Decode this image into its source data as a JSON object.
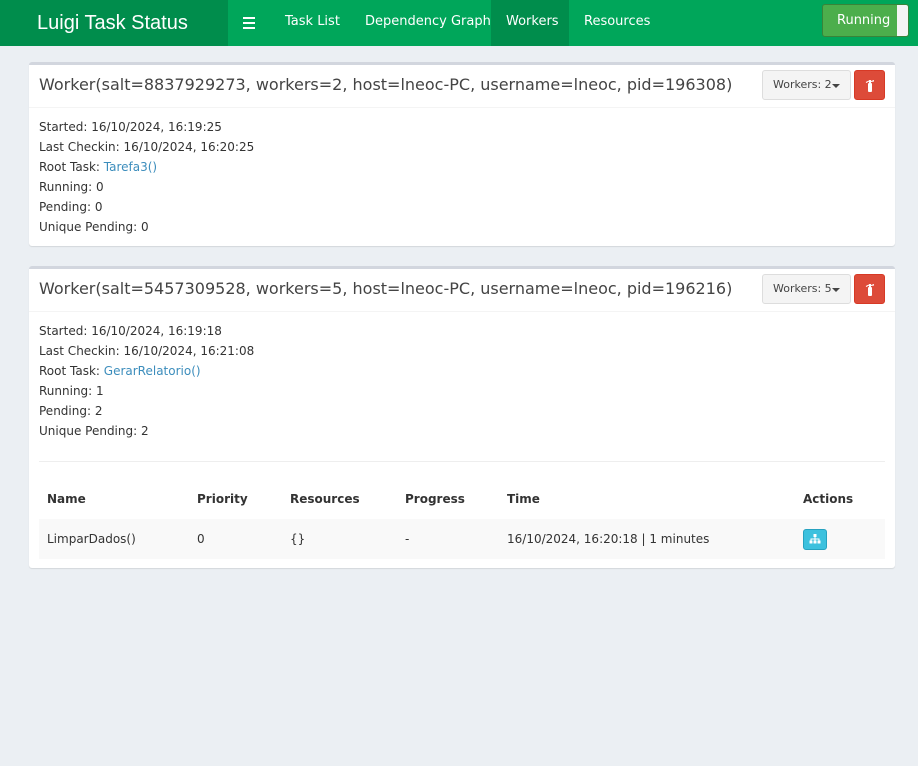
{
  "app": {
    "title": "Luigi Task Status",
    "status_label": "Running"
  },
  "nav": {
    "items": [
      "Task List",
      "Dependency Graph",
      "Workers",
      "Resources"
    ],
    "active": "Workers"
  },
  "colors": {
    "nav_bg": "#00a65a",
    "brand_bg": "#008d4c",
    "danger": "#dd4b39",
    "link": "#3c8dbc",
    "info": "#3cc1de"
  },
  "workers": [
    {
      "title": "Worker(salt=8837929273, workers=2, host=lneoc-PC, username=lneoc, pid=196308)",
      "workers_btn": "Workers: 2",
      "started_label": "Started:",
      "started": "16/10/2024, 16:19:25",
      "checkin_label": "Last Checkin:",
      "checkin": "16/10/2024, 16:20:25",
      "root_label": "Root Task:",
      "root_task": "Tarefa3()",
      "running_label": "Running:",
      "running": "0",
      "pending_label": "Pending:",
      "pending": "0",
      "unique_label": "Unique Pending:",
      "unique_pending": "0"
    },
    {
      "title": "Worker(salt=5457309528, workers=5, host=lneoc-PC, username=lneoc, pid=196216)",
      "workers_btn": "Workers: 5",
      "started_label": "Started:",
      "started": "16/10/2024, 16:19:18",
      "checkin_label": "Last Checkin:",
      "checkin": "16/10/2024, 16:21:08",
      "root_label": "Root Task:",
      "root_task": "GerarRelatorio()",
      "running_label": "Running:",
      "running": "1",
      "pending_label": "Pending:",
      "pending": "2",
      "unique_label": "Unique Pending:",
      "unique_pending": "2",
      "table": {
        "headers": [
          "Name",
          "Priority",
          "Resources",
          "Progress",
          "Time",
          "Actions"
        ],
        "rows": [
          {
            "name": "LimparDados()",
            "priority": "0",
            "resources": "{}",
            "progress": "-",
            "time": "16/10/2024, 16:20:18 | 1 minutes"
          }
        ]
      }
    }
  ],
  "icons": {
    "menu": "hamburger-icon",
    "kill": "fire-extinguisher-icon",
    "graph": "sitemap-icon",
    "caret": "caret-down-icon"
  }
}
